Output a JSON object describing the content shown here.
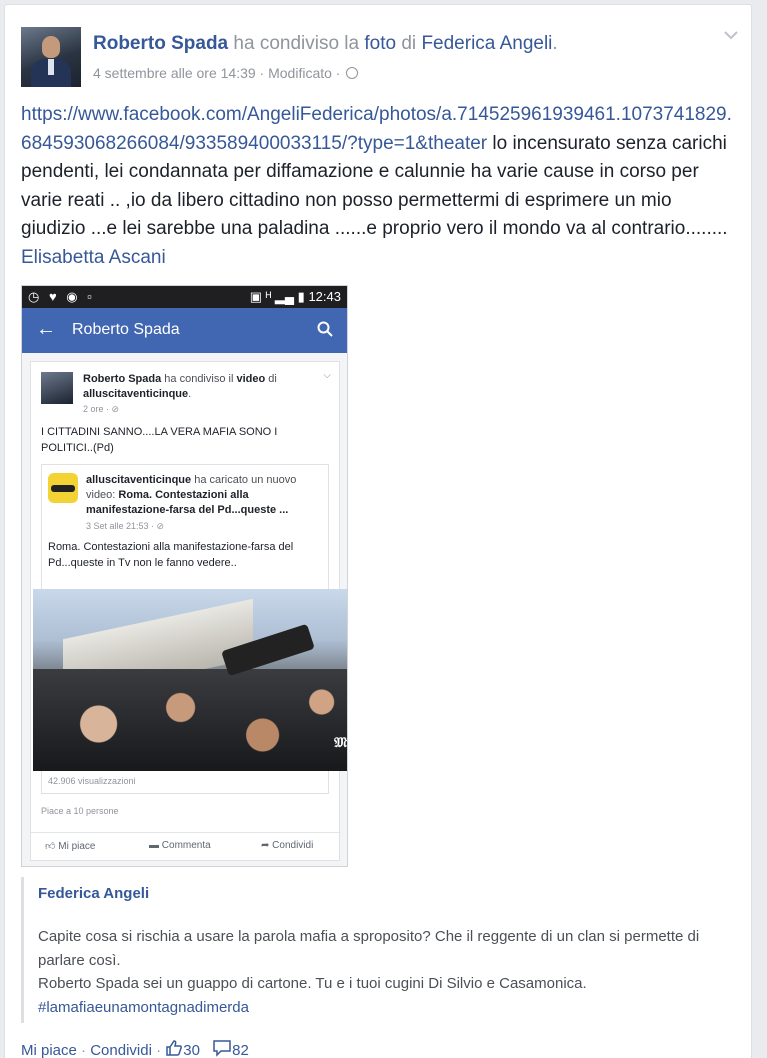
{
  "post": {
    "author": "Roberto Spada",
    "action_prefix": " ha condiviso la ",
    "object": "foto",
    "middle": " di ",
    "target": "Federica Angeli",
    "suffix": ".",
    "timestamp": "4 settembre alle ore 14:39",
    "edited": " · Modificato · ",
    "link": "https://www.facebook.com/AngeliFederica/photos/a.714525961939461.1073741829.684593068266084/933589400033115/?type=1&theater",
    "body": " lo incensurato senza carichi pendenti, lei condannata per diffamazione e calunnie ha varie cause in corso per varie reati .. ,io da libero cittadino non posso permettermi di esprimere un mio giudizio ...e lei sarebbe una paladina ......e proprio vero il mondo va al contrario........ ",
    "mention": "Elisabetta Ascani"
  },
  "screenshot": {
    "status_time": "12:43",
    "status_icons": "◷ ♥ ◉ ▫",
    "status_right": "▣ ᴴ ▂▄ ▮",
    "nav_title": "Roberto Spada",
    "back_icon": "←",
    "inner_author": "Roberto Spada",
    "inner_action": " ha condiviso il ",
    "inner_object": "video",
    "inner_mid": " di ",
    "inner_target": "alluscitaventicinque",
    "inner_end": ".",
    "inner_meta": "2 ore · ⊘",
    "inner_text": "I CITTADINI SANNO....LA VERA MAFIA SONO I POLITICI..(Pd)",
    "shared_author": "alluscitaventicinque",
    "shared_action": " ha caricato un nuovo video: ",
    "shared_title": "Roma. Contestazioni alla manifestazione-farsa del Pd...queste ...",
    "shared_meta": "3 Set alle 21:53 · ⊘",
    "shared_text": "Roma. Contestazioni alla manifestazione-farsa del Pd...queste in Tv non le fanno vedere..",
    "video_mark": "𝔐",
    "views": "42.906 visualizzazioni",
    "likes": "Piace a 10 persone",
    "like_btn": "Mi piace",
    "comment_btn": "Commenta",
    "share_btn": "Condividi"
  },
  "quote": {
    "name": "Federica Angeli",
    "line1": "Capite cosa si rischia a usare la parola mafia a sproposito? Che il reggente di un clan si permette di parlare così.",
    "line2": "Roberto Spada sei un guappo di cartone. Tu e i tuoi cugini Di Silvio e Casamonica.",
    "hashtag": "#lamafiaeunamontagnadimerda"
  },
  "footer": {
    "like": "Mi piace",
    "sep1": " · ",
    "share": "Condividi",
    "sep2": " · ",
    "like_count": "30",
    "comment_count": "82"
  },
  "colors": {
    "link": "#365899",
    "fb_blue": "#4267b2",
    "muted": "#90949c"
  }
}
